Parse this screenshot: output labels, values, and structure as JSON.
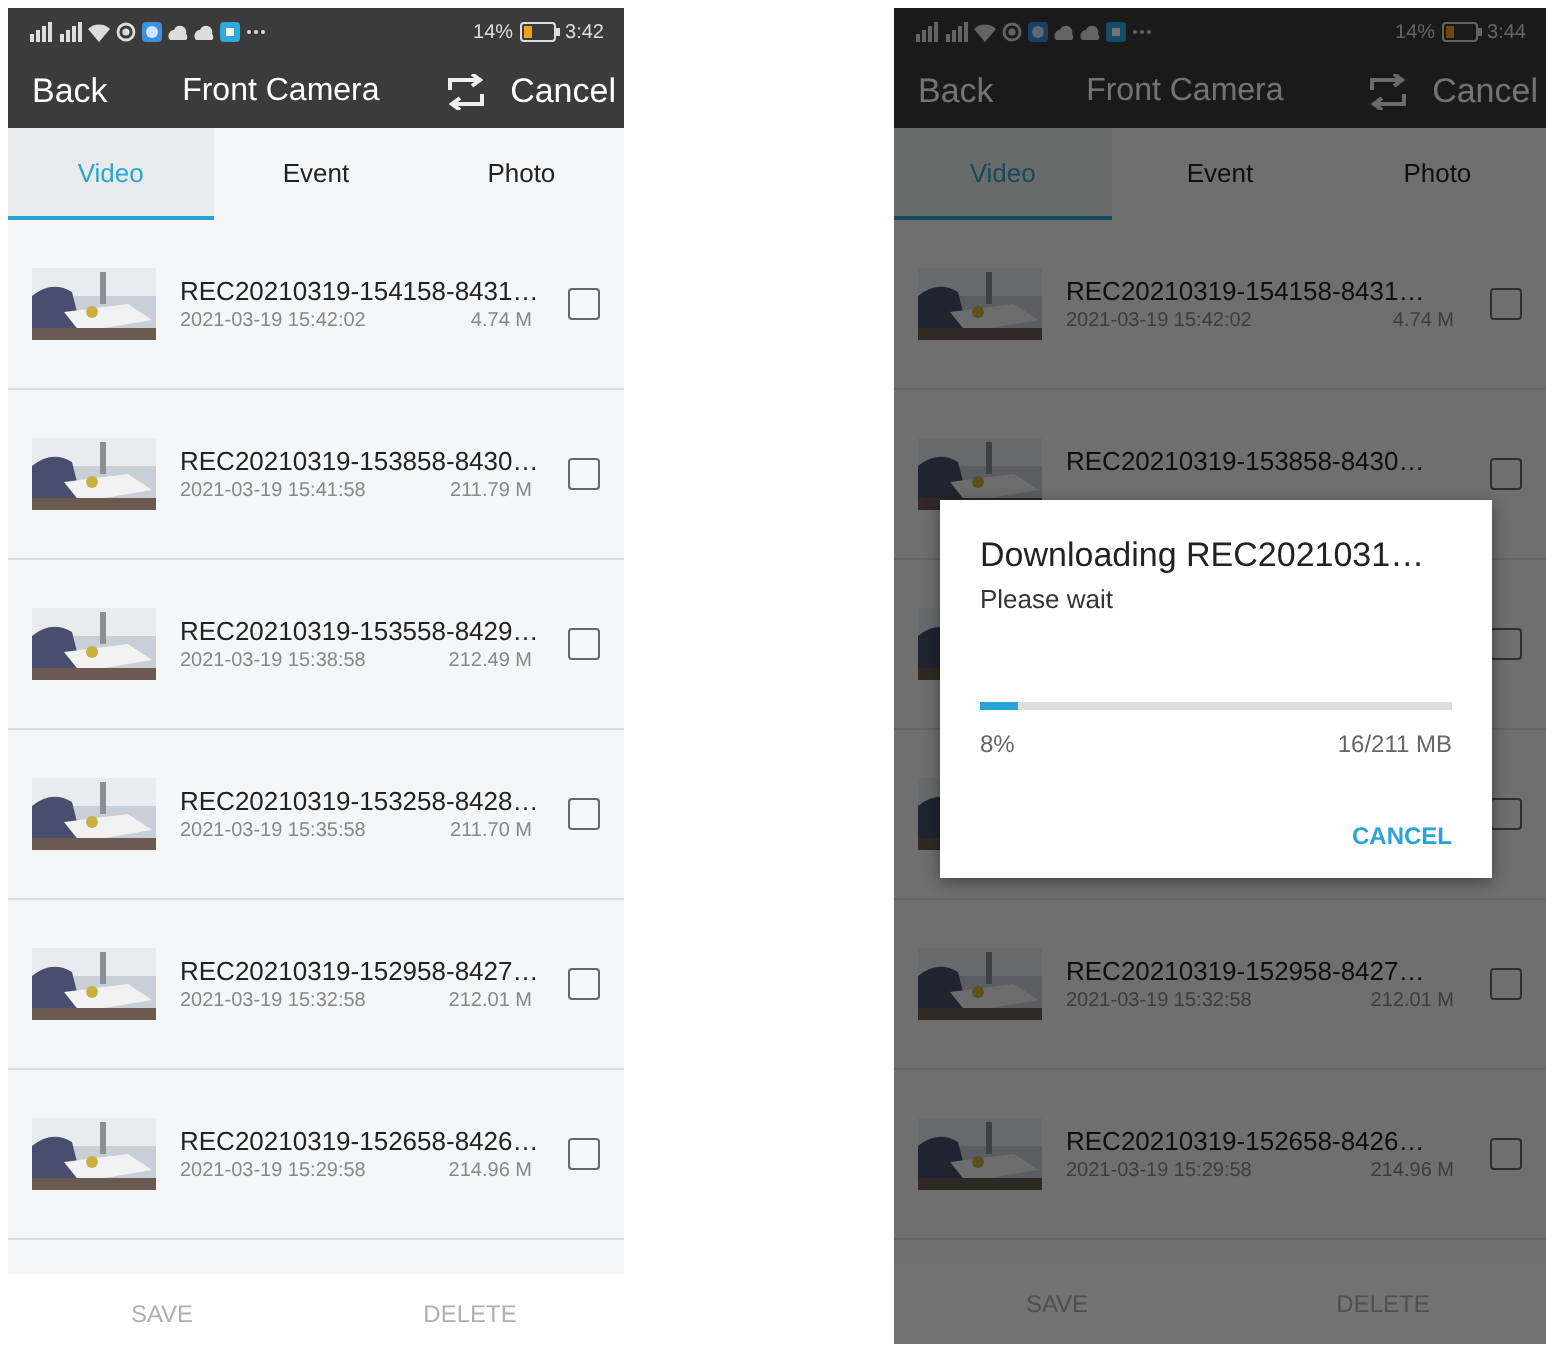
{
  "screens": [
    {
      "status_bar": {
        "battery": "14%",
        "time": "3:42"
      },
      "header": {
        "back": "Back",
        "title": "Front Camera",
        "cancel": "Cancel"
      },
      "tabs": [
        {
          "label": "Video",
          "selected": true
        },
        {
          "label": "Event",
          "selected": false
        },
        {
          "label": "Photo",
          "selected": false
        }
      ],
      "files": [
        {
          "name": "REC20210319-154158-8431…",
          "date": "2021-03-19 15:42:02",
          "size": "4.74 M",
          "checked": false
        },
        {
          "name": "REC20210319-153858-8430…",
          "date": "2021-03-19 15:41:58",
          "size": "211.79 M",
          "checked": false
        },
        {
          "name": "REC20210319-153558-8429…",
          "date": "2021-03-19 15:38:58",
          "size": "212.49 M",
          "checked": false
        },
        {
          "name": "REC20210319-153258-8428…",
          "date": "2021-03-19 15:35:58",
          "size": "211.70 M",
          "checked": false
        },
        {
          "name": "REC20210319-152958-8427…",
          "date": "2021-03-19 15:32:58",
          "size": "212.01 M",
          "checked": false
        },
        {
          "name": "REC20210319-152658-8426…",
          "date": "2021-03-19 15:29:58",
          "size": "214.96 M",
          "checked": false
        }
      ],
      "actions": [
        {
          "label": "SAVE",
          "disabled": true
        },
        {
          "label": "DELETE",
          "disabled": true
        }
      ]
    },
    {
      "status_bar": {
        "battery": "14%",
        "time": "3:44"
      },
      "header": {
        "back": "Back",
        "title": "Front Camera",
        "cancel": "Cancel"
      },
      "tabs": [
        {
          "label": "Video",
          "selected": true
        },
        {
          "label": "Event",
          "selected": false
        },
        {
          "label": "Photo",
          "selected": false
        }
      ],
      "files": [
        {
          "name": "REC20210319-154158-8431…",
          "date": "2021-03-19 15:42:02",
          "size": "4.74 M",
          "checked": false
        },
        {
          "name": "REC20210319-153858-8430…",
          "checked": false
        },
        {
          "checked": false
        },
        {
          "checked": false
        },
        {
          "name": "REC20210319-152958-8427…",
          "date": "2021-03-19 15:32:58",
          "size": "212.01 M",
          "checked": false
        },
        {
          "name": "REC20210319-152658-8426…",
          "date": "2021-03-19 15:29:58",
          "size": "214.96 M",
          "checked": false
        }
      ],
      "actions": [
        {
          "label": "SAVE",
          "disabled": true
        },
        {
          "label": "DELETE",
          "disabled": true
        }
      ],
      "dialog": {
        "title": "Downloading REC2021031…",
        "message": "Please wait",
        "level": 0.08,
        "percent": "8%",
        "progress": "16/211 MB",
        "button": "CANCEL"
      }
    }
  ]
}
